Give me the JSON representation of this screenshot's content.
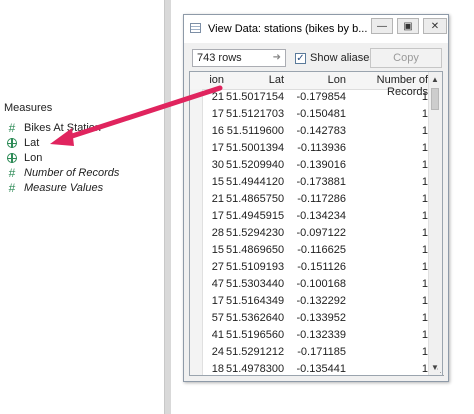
{
  "measures": {
    "title": "Measures",
    "items": [
      {
        "label": "Bikes At Station",
        "icon": "hash-icon",
        "italic": false
      },
      {
        "label": "Lat",
        "icon": "globe-icon",
        "italic": false
      },
      {
        "label": "Lon",
        "icon": "globe-icon",
        "italic": false
      },
      {
        "label": "Number of Records",
        "icon": "hash-icon",
        "italic": true
      },
      {
        "label": "Measure Values",
        "icon": "hash-icon",
        "italic": true
      }
    ]
  },
  "dialog": {
    "title": "View Data:  stations (bikes by b...",
    "rows_count": "743 rows",
    "show_aliases_label": "Show aliases",
    "show_aliases_checked": true,
    "copy_label": "Copy",
    "columns": [
      "ion",
      "Lat",
      "Lon",
      "Number of Records"
    ],
    "rows": [
      [
        "21",
        "51.5017154",
        "-0.179854",
        "1"
      ],
      [
        "17",
        "51.5121703",
        "-0.150481",
        "1"
      ],
      [
        "16",
        "51.5119600",
        "-0.142783",
        "1"
      ],
      [
        "17",
        "51.5001394",
        "-0.113936",
        "1"
      ],
      [
        "30",
        "51.5209940",
        "-0.139016",
        "1"
      ],
      [
        "15",
        "51.4944120",
        "-0.173881",
        "1"
      ],
      [
        "21",
        "51.4865750",
        "-0.117286",
        "1"
      ],
      [
        "17",
        "51.4945915",
        "-0.134234",
        "1"
      ],
      [
        "28",
        "51.5294230",
        "-0.097122",
        "1"
      ],
      [
        "15",
        "51.4869650",
        "-0.116625",
        "1"
      ],
      [
        "27",
        "51.5109193",
        "-0.151126",
        "1"
      ],
      [
        "47",
        "51.5303440",
        "-0.100168",
        "1"
      ],
      [
        "17",
        "51.5164349",
        "-0.132292",
        "1"
      ],
      [
        "57",
        "51.5362640",
        "-0.133952",
        "1"
      ],
      [
        "41",
        "51.5196560",
        "-0.132339",
        "1"
      ],
      [
        "24",
        "51.5291212",
        "-0.171185",
        "1"
      ],
      [
        "18",
        "51.4978300",
        "-0.135441",
        "1"
      ]
    ]
  },
  "colors": {
    "annotation_arrow": "#e0245e",
    "measure_icon": "#2e8b57"
  }
}
